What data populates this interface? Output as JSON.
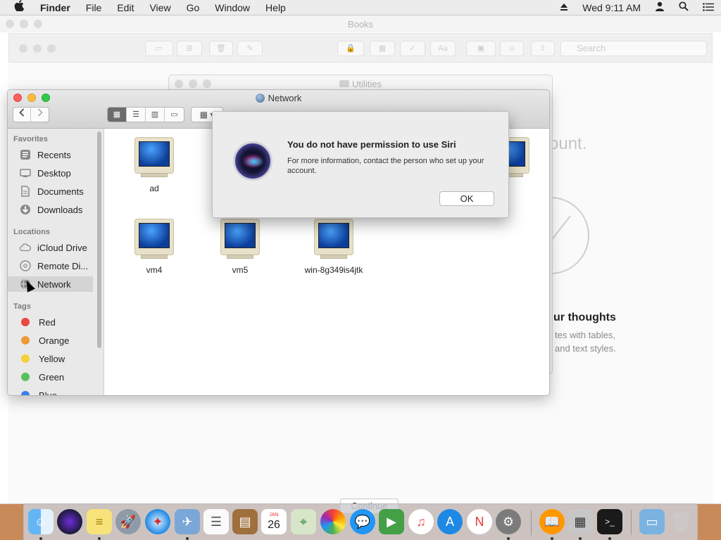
{
  "menubar": {
    "apple_icon": "apple-logo",
    "app_name": "Finder",
    "items": [
      "File",
      "Edit",
      "View",
      "Go",
      "Window",
      "Help"
    ],
    "clock": "Wed 9:11 AM",
    "status_icons": [
      "eject-icon",
      "user-icon",
      "spotlight-icon",
      "notification-list-icon"
    ]
  },
  "books_window": {
    "title": "Books",
    "search_placeholder": "Search",
    "partial_text_1": "ount.",
    "partial_text_2": "ur thoughts",
    "partial_text_3": "tes with tables,",
    "partial_text_4": "and text styles.",
    "continue_label": "Continue"
  },
  "utilities_window": {
    "title": "Utilities"
  },
  "finder": {
    "title": "Network",
    "sidebar": {
      "favorites_header": "Favorites",
      "favorites": [
        {
          "label": "Recents",
          "icon": "clock-icon"
        },
        {
          "label": "Desktop",
          "icon": "desktop-icon"
        },
        {
          "label": "Documents",
          "icon": "documents-icon"
        },
        {
          "label": "Downloads",
          "icon": "downloads-icon"
        }
      ],
      "locations_header": "Locations",
      "locations": [
        {
          "label": "iCloud Drive",
          "icon": "cloud-icon"
        },
        {
          "label": "Remote Di...",
          "icon": "disc-icon"
        },
        {
          "label": "Network",
          "icon": "globe-icon"
        }
      ],
      "tags_header": "Tags",
      "tags": [
        {
          "label": "Red",
          "color": "#e9483f"
        },
        {
          "label": "Orange",
          "color": "#f09a37"
        },
        {
          "label": "Yellow",
          "color": "#f5d03b"
        },
        {
          "label": "Green",
          "color": "#5ac05a"
        },
        {
          "label": "Blue",
          "color": "#3b7ee8"
        }
      ]
    },
    "computers": [
      {
        "label": "ad"
      },
      {
        "label": "vm4"
      },
      {
        "label": "vm5"
      },
      {
        "label": "win-8g349is4jtk"
      }
    ]
  },
  "dialog": {
    "title": "You do not have permission to use Siri",
    "message": "For more information, contact the person who set up your account.",
    "ok_label": "OK"
  },
  "dock": {
    "calendar_month": "JAN",
    "calendar_day": "26"
  }
}
